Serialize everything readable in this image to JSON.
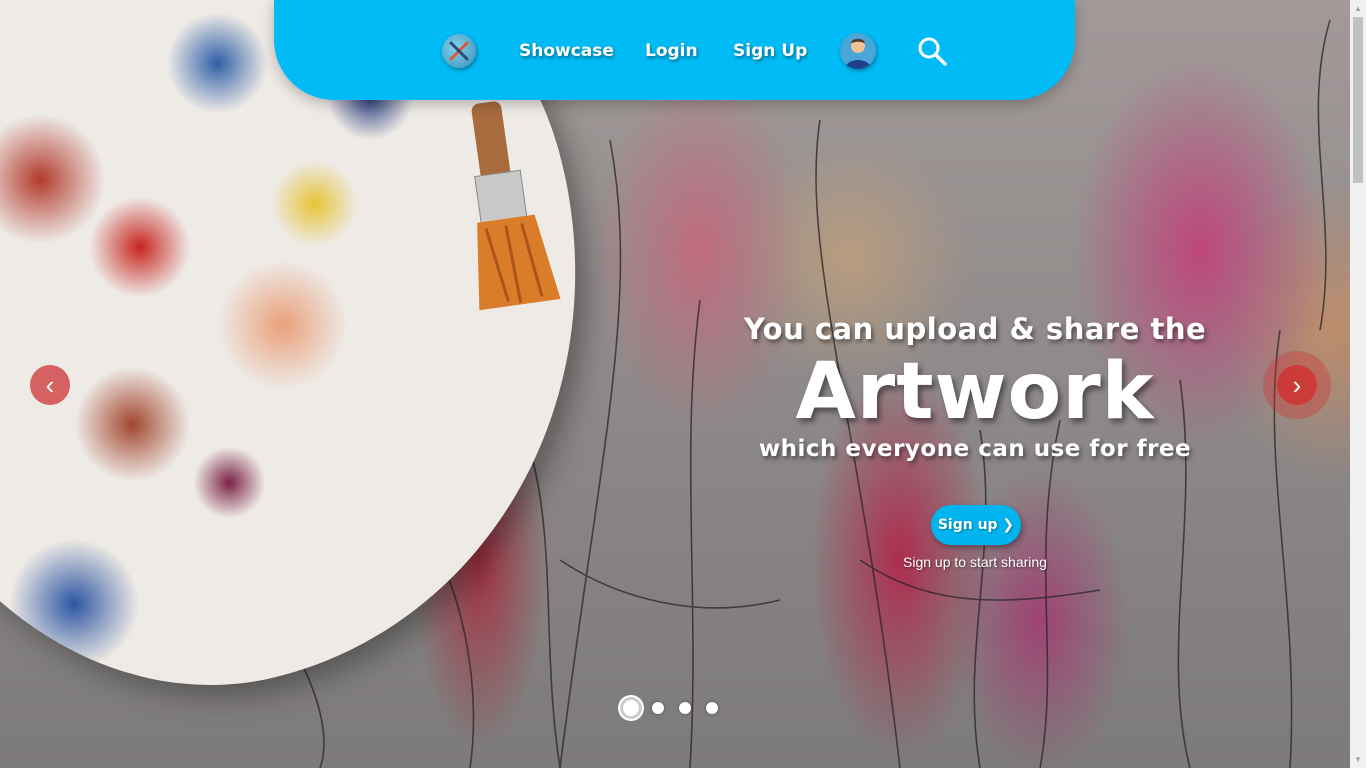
{
  "nav": {
    "logo_icon": "palette-brush-icon",
    "items": [
      {
        "label": "Showcase"
      },
      {
        "label": "Login"
      },
      {
        "label": "Sign Up"
      }
    ],
    "user_icon": "user-avatar-icon",
    "search_icon": "search-icon"
  },
  "hero": {
    "line1": "You can upload & share the",
    "line2": "Artwork",
    "line3": "which everyone can use for free",
    "cta_label": "Sign up ❯",
    "cta_subtext": "Sign up to start sharing",
    "prev_arrow": "‹",
    "next_arrow": "›"
  },
  "carousel": {
    "slide_count": 4,
    "active_slide": 1
  },
  "colors": {
    "nav_bg": "#00bbf5",
    "cta_bg": "#00b4f0",
    "arrow_red": "#d22d2d"
  }
}
